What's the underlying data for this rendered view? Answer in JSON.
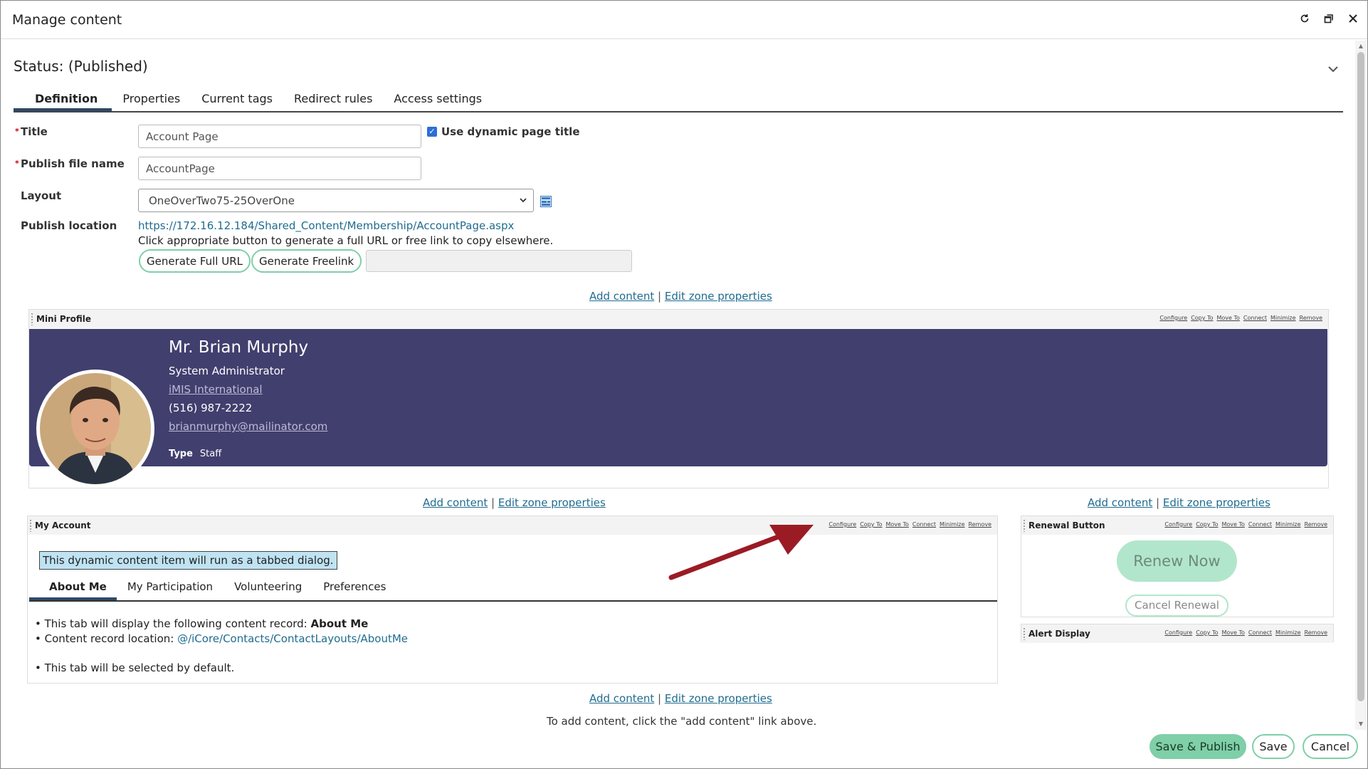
{
  "window": {
    "title": "Manage content",
    "controls": [
      "refresh-icon",
      "restore-icon",
      "close-icon"
    ]
  },
  "status": {
    "label": "Status: (Published)"
  },
  "tabs": [
    {
      "label": "Definition",
      "active": true
    },
    {
      "label": "Properties"
    },
    {
      "label": "Current tags"
    },
    {
      "label": "Redirect rules"
    },
    {
      "label": "Access settings"
    }
  ],
  "form": {
    "title_label": "Title",
    "title_value": "Account Page",
    "dynamic_title_label": "Use dynamic page title",
    "dynamic_title_checked": true,
    "publish_file_label": "Publish file name",
    "publish_file_value": "AccountPage",
    "layout_label": "Layout",
    "layout_value": "OneOverTwo75-25OverOne",
    "publish_location_label": "Publish location",
    "publish_location_url": "https://172.16.12.184/Shared_Content/Membership/AccountPage.aspx",
    "hint": "Click appropriate button to generate a full URL or free link to copy elsewhere.",
    "gen_full_url": "Generate Full URL",
    "gen_freelink": "Generate Freelink",
    "generated_value": ""
  },
  "zone": {
    "add_content": "Add content",
    "separator": "|",
    "edit_zone": "Edit zone properties"
  },
  "part_links": [
    "Configure",
    "Copy To",
    "Move To",
    "Connect",
    "Minimize",
    "Remove"
  ],
  "mini_profile": {
    "header": "Mini Profile",
    "name": "Mr. Brian Murphy",
    "role": "System Administrator",
    "company": "iMIS International",
    "phone": "(516) 987-2222",
    "email": "brianmurphy@mailinator.com",
    "type_label": "Type",
    "type_value": "Staff",
    "banner_color": "#413f6e"
  },
  "my_account": {
    "header": "My Account",
    "info": "This dynamic content item will run as a tabbed dialog.",
    "subtabs": [
      {
        "label": "About Me",
        "active": true
      },
      {
        "label": "My Participation"
      },
      {
        "label": "Volunteering"
      },
      {
        "label": "Preferences"
      }
    ],
    "line1_prefix": "This tab will display the following content record: ",
    "line1_record": "About Me",
    "line2_prefix": "Content record location: ",
    "line2_path": "@/iCore/Contacts/ContactLayouts/AboutMe",
    "line3": "This tab will be selected by default."
  },
  "renewal": {
    "header": "Renewal Button",
    "renew": "Renew Now",
    "cancel": "Cancel Renewal"
  },
  "alert": {
    "header": "Alert Display"
  },
  "footnote": "To add content, click the \"add content\" link above.",
  "footer": {
    "save_publish": "Save & Publish",
    "save": "Save",
    "cancel": "Cancel"
  },
  "colors": {
    "accent_green": "#7fcfa8",
    "link": "#1f6c8f",
    "annotation_arrow": "#9b1b24"
  }
}
